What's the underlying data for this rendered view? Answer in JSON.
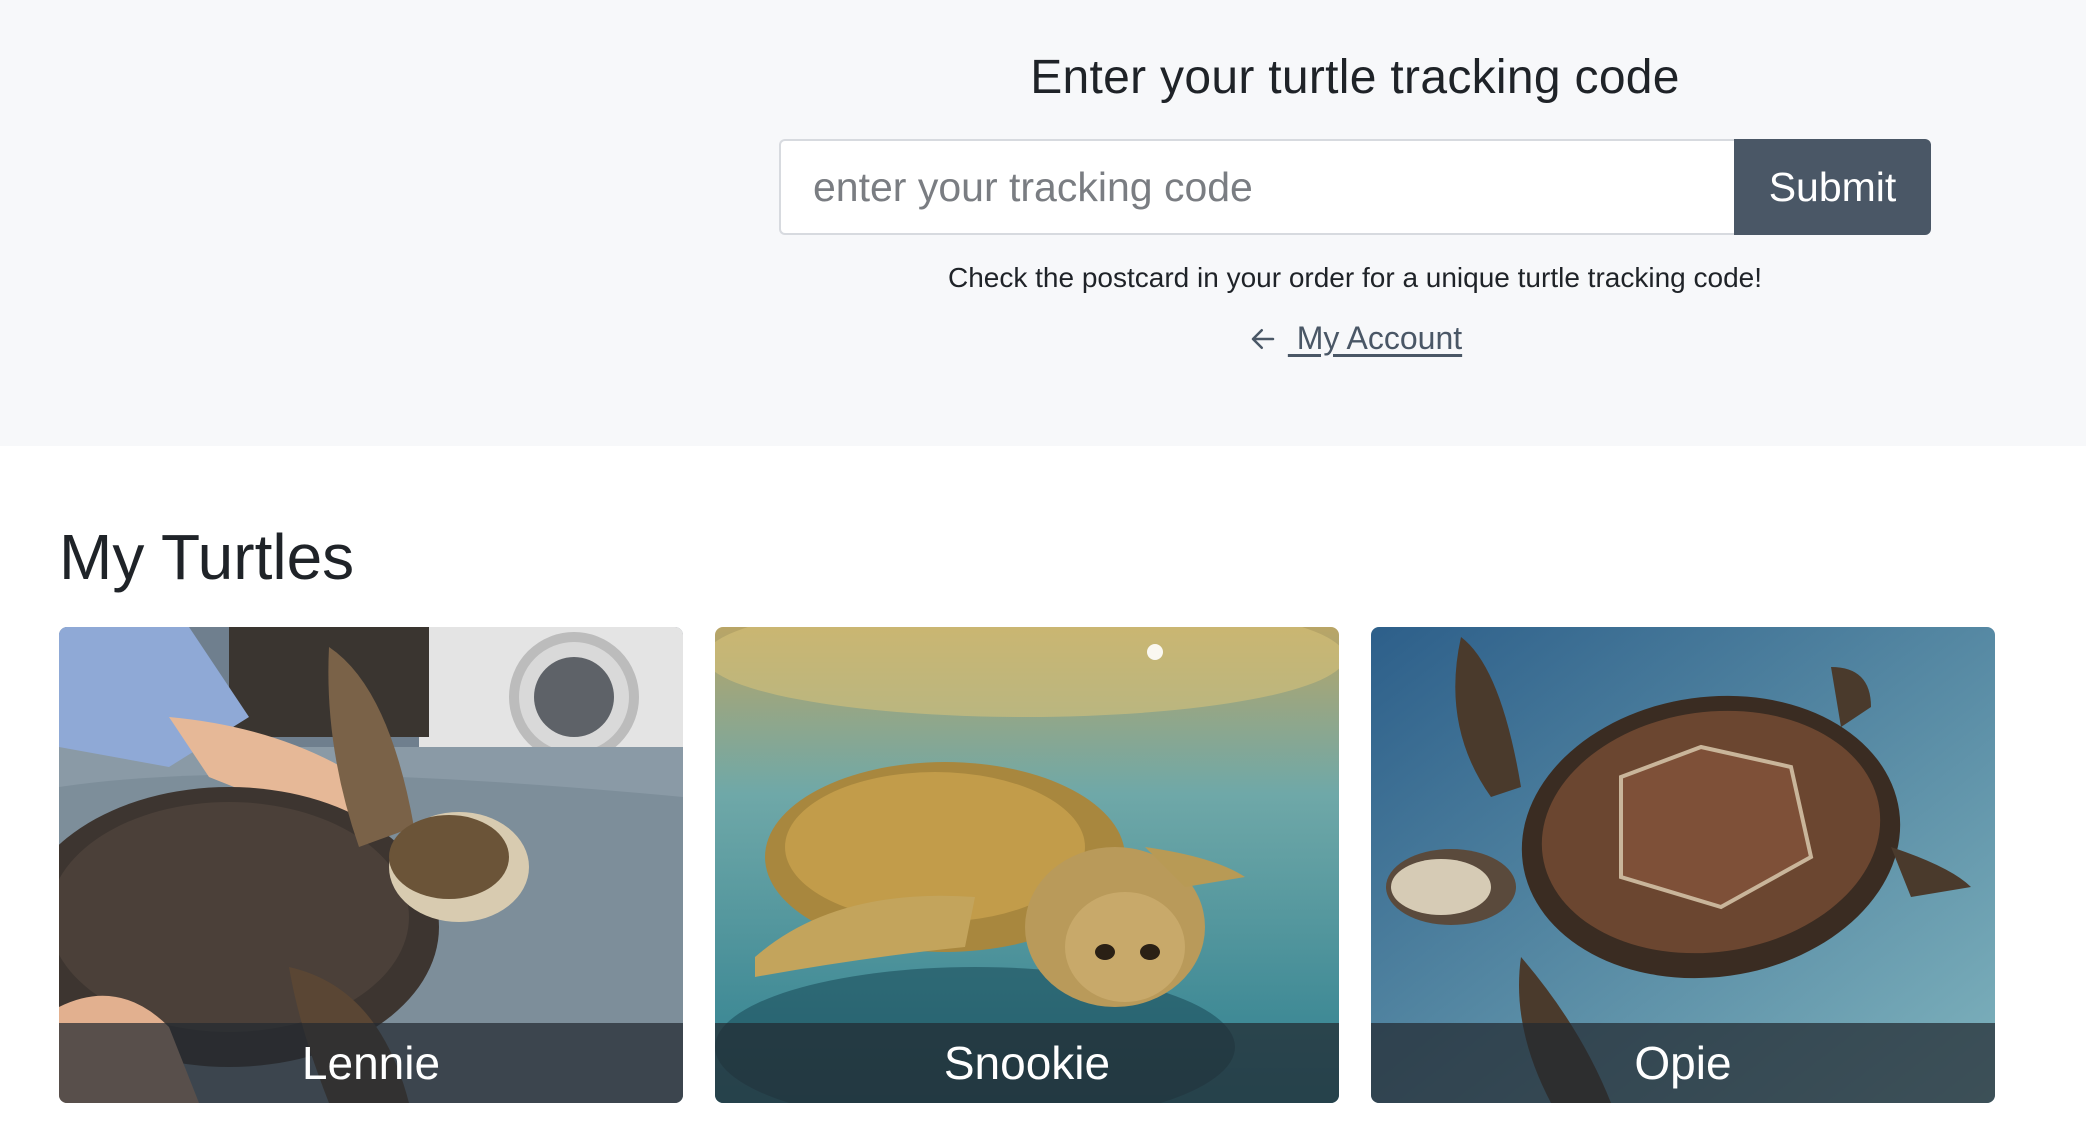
{
  "tracker": {
    "title": "Enter your turtle tracking code",
    "input_placeholder": "enter your tracking code",
    "input_value": "",
    "submit_label": "Submit",
    "hint": "Check the postcard in your order for a unique turtle tracking code!",
    "back_link_label": " My Account",
    "back_icon": "arrow-left-icon"
  },
  "turtles": {
    "heading": "My Turtles",
    "items": [
      {
        "name": "Lennie",
        "photo_theme": "turtle held on towel indoors"
      },
      {
        "name": "Snookie",
        "photo_theme": "turtle swimming underwater"
      },
      {
        "name": "Opie",
        "photo_theme": "green sea turtle on blue background"
      }
    ]
  },
  "colors": {
    "header_bg": "#f7f8fa",
    "button_bg": "#4a5766",
    "link_color": "#4a5766",
    "label_overlay": "rgba(35,42,48,0.72)"
  }
}
